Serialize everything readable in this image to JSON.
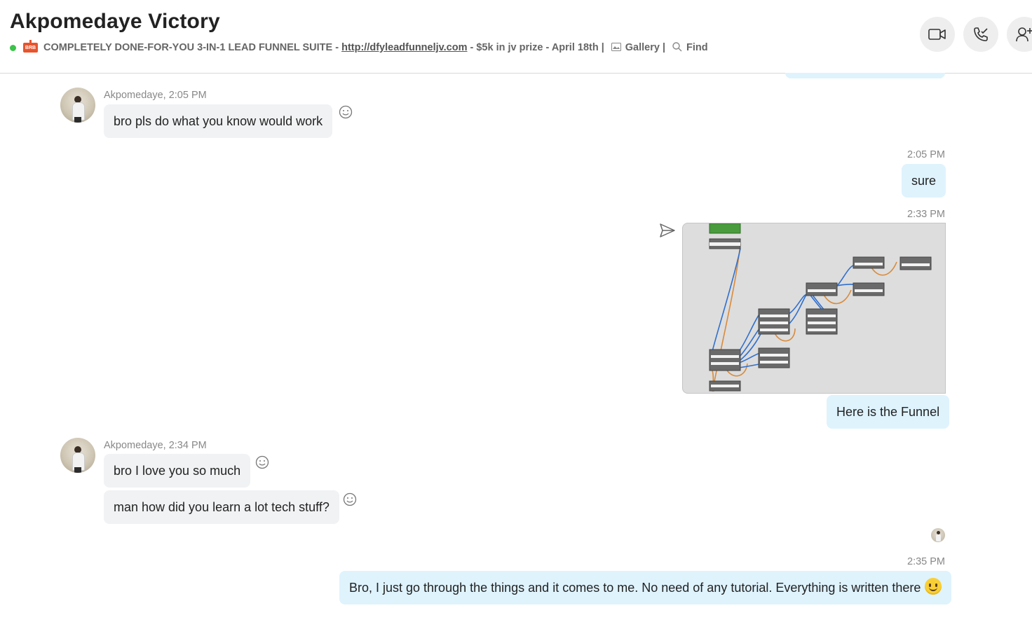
{
  "header": {
    "title": "Akpomedaye Victory",
    "status_color": "#3cc34a",
    "brb_badge": "BRB",
    "mood_prefix": "COMPLETELY DONE-FOR-YOU 3-IN-1 LEAD FUNNEL SUITE - ",
    "mood_link": "http://dfyleadfunneljv.com",
    "mood_suffix": " - $5k in jv prize - April 18th |",
    "gallery_label": "Gallery |",
    "find_label": "Find",
    "buttons": [
      "video-call",
      "audio-call",
      "add-people"
    ]
  },
  "messages": [
    {
      "sender_line": "Akpomedaye, 2:05 PM",
      "bubbles": [
        "bro pls do what you know would work"
      ]
    },
    {
      "time": "2:05 PM",
      "text": "sure"
    },
    {
      "time": "2:33 PM",
      "image": "funnel-diagram",
      "caption": "Here is the Funnel"
    },
    {
      "sender_line": "Akpomedaye, 2:34 PM",
      "bubbles": [
        "bro I love you so much",
        "man how did you learn a lot tech stuff?"
      ]
    },
    {
      "time": "2:35 PM",
      "text": "Bro, I just go through the things and it comes to me. No need of any tutorial. Everything is written there",
      "emoji": "slightly-smiling-face"
    }
  ],
  "colors": {
    "incoming_bubble": "#f1f2f4",
    "outgoing_bubble": "#dff3fd",
    "connector_blue": "#2f6fce",
    "connector_orange": "#d98a3a"
  }
}
